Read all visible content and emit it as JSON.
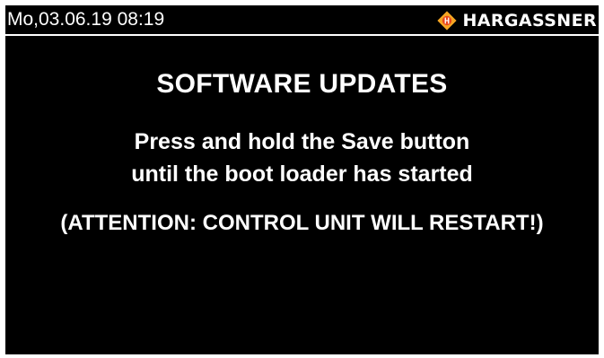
{
  "status_bar": {
    "datetime": "Mo,03.06.19 08:19",
    "brand_icon": "hargassner-flame-logo-icon",
    "brand_name": "HARGASSNER"
  },
  "screen": {
    "title": "SOFTWARE UPDATES",
    "message_line_1": "Press and hold the Save button",
    "message_line_2": "until the boot loader has started",
    "warning": "(ATTENTION: CONTROL UNIT WILL RESTART!)"
  },
  "colors": {
    "background": "#000000",
    "text": "#ffffff",
    "logo_accent": "#f5a623",
    "logo_inner": "#e8471c"
  }
}
